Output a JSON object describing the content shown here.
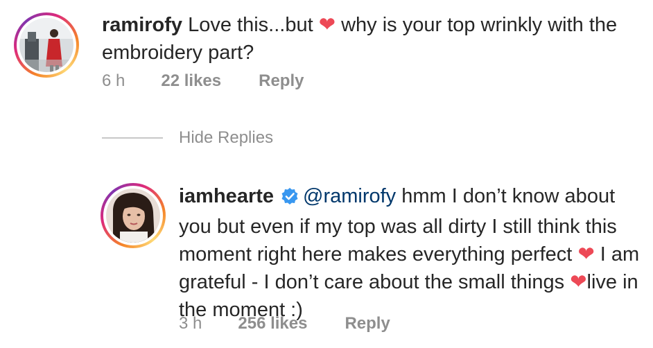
{
  "comment": {
    "username": "ramirofy",
    "text_before": " Love this...but ",
    "heart": "❤",
    "text_after": " why is your top wrinkly with the embroidery part?",
    "time": "6 h",
    "likes": "22 likes",
    "reply_label": "Reply"
  },
  "hide_replies_label": "Hide Replies",
  "reply": {
    "username": "iamhearte",
    "mention": "@ramirofy",
    "text_1": " hmm I don’t know about you but even if my top was all dirty I still think this moment right here makes everything perfect ",
    "heart_1": "❤",
    "text_2": " I am grateful - I don’t care about the small things ",
    "heart_2": "❤",
    "text_3": "live in the moment :)",
    "time": "3 h",
    "likes": "256 likes",
    "reply_label": "Reply"
  },
  "colors": {
    "text": "#262626",
    "meta": "#8e8e8e",
    "mention": "#00376b",
    "heart": "#ed4956",
    "verified": "#3897f0"
  }
}
